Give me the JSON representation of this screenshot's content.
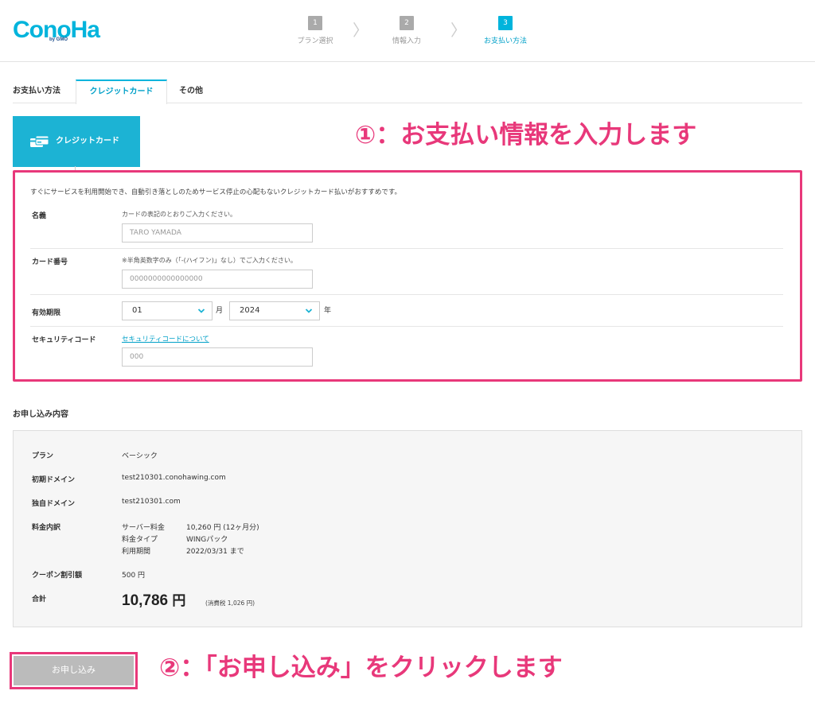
{
  "header": {
    "logo_text": "ConoHa",
    "logo_sub": "by GMO",
    "steps": [
      {
        "num": "1",
        "label": "プラン選択",
        "active": false
      },
      {
        "num": "2",
        "label": "情報入力",
        "active": false
      },
      {
        "num": "3",
        "label": "お支払い方法",
        "active": true
      }
    ],
    "step_separator": "〉"
  },
  "tabs": {
    "section_label": "お支払い方法",
    "items": [
      {
        "label": "クレジットカード",
        "active": true
      },
      {
        "label": "その他",
        "active": false
      }
    ]
  },
  "payment_type_card": {
    "label": "クレジットカード",
    "icon": "credit-card-icon"
  },
  "annotations": {
    "step1": "①：お支払い情報を入力します",
    "step2": "②：「お申し込み」をクリックします"
  },
  "form": {
    "intro": "すぐにサービスを利用開始でき、自動引き落としのためサービス停止の心配もないクレジットカード払いがおすすめです。",
    "name": {
      "label": "名義",
      "hint": "カードの表記のとおりご入力ください。",
      "placeholder": "TARO YAMADA"
    },
    "card_number": {
      "label": "カード番号",
      "hint": "※半角英数字のみ（「-(ハイフン)」なし）でご入力ください。",
      "placeholder": "0000000000000000"
    },
    "expiry": {
      "label": "有効期限",
      "month_value": "01",
      "month_unit": "月",
      "year_value": "2024",
      "year_unit": "年"
    },
    "security_code": {
      "label": "セキュリティコード",
      "link": "セキュリティコードについて",
      "placeholder": "000"
    }
  },
  "summary": {
    "title": "お申し込み内容",
    "plan": {
      "label": "プラン",
      "value": "ベーシック"
    },
    "initial_domain": {
      "label": "初期ドメイン",
      "value": "test210301.conohawing.com"
    },
    "own_domain": {
      "label": "独自ドメイン",
      "value": "test210301.com"
    },
    "fee_breakdown": {
      "label": "料金内訳",
      "rows": [
        {
          "name": "サーバー料金",
          "value": "10,260 円 (12ヶ月分)"
        },
        {
          "name": "料金タイプ",
          "value": "WINGパック"
        },
        {
          "name": "利用期間",
          "value": "2022/03/31 まで"
        }
      ]
    },
    "coupon": {
      "label": "クーポン割引額",
      "value": "500 円"
    },
    "total": {
      "label": "合計",
      "amount": "10,786",
      "unit": "円",
      "tax_note": "(消費税 1,026 円)"
    }
  },
  "submit": {
    "label": "お申し込み"
  },
  "colors": {
    "accent": "#00b4dc",
    "highlight": "#e8387a",
    "card_bg": "#1cb3d4",
    "submit_bg": "#bbbbbb"
  }
}
